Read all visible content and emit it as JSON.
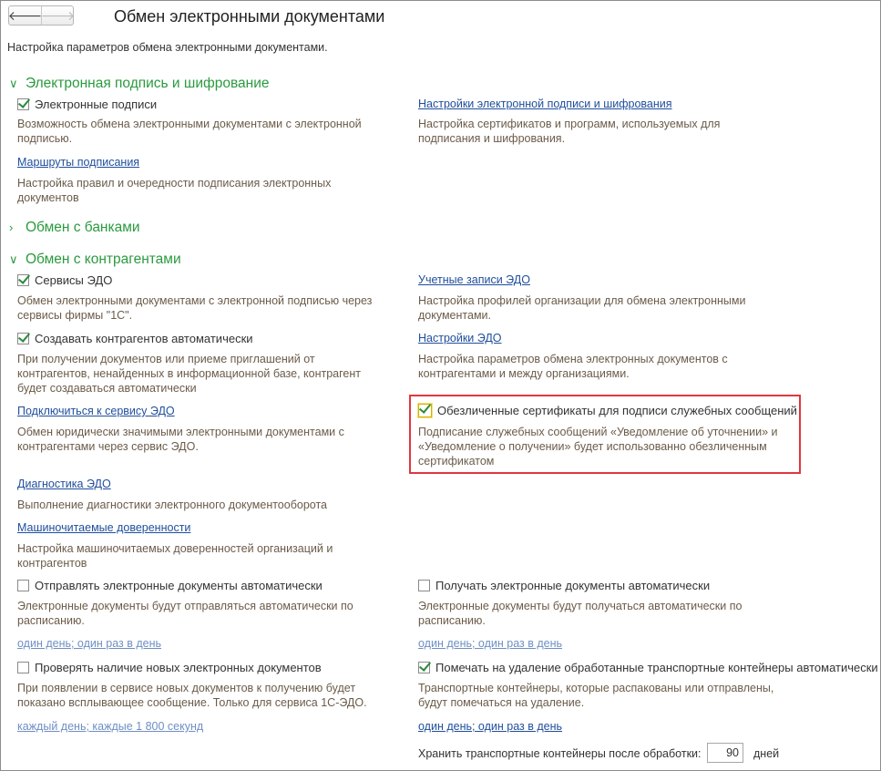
{
  "header": {
    "title": "Обмен электронными документами",
    "back": "🡐",
    "forward": "🡒"
  },
  "subtitle": "Настройка параметров обмена электронными документами.",
  "sections": {
    "signature": {
      "title": "Электронная подпись и шифрование",
      "esig_checkbox": "Электронные подписи",
      "esig_desc": "Возможность обмена электронными документами с электронной подписью.",
      "routes_link": "Маршруты подписания",
      "routes_desc": "Настройка правил и очередности подписания электронных документов",
      "settings_link": "Настройки электронной подписи и шифрования",
      "settings_desc": "Настройка сертификатов и программ, используемых для подписания и шифрования."
    },
    "banks": {
      "title": "Обмен с банками"
    },
    "counterparties": {
      "title": "Обмен с контрагентами",
      "edo_services_checkbox": "Сервисы ЭДО",
      "edo_services_desc": "Обмен электронными документами с электронной подписью через сервисы фирмы \"1С\".",
      "create_auto_checkbox": "Создавать контрагентов автоматически",
      "create_auto_desc": "При получении документов или приеме приглашений от контрагентов, ненайденных в информационной базе, контрагент будет создаваться автоматически",
      "connect_link": "Подключиться к сервису ЭДО",
      "connect_desc": "Обмен юридически значимыми электронными документами с контрагентами через сервис ЭДО.",
      "diagnostics_link": "Диагностика ЭДО",
      "diagnostics_desc": "Выполнение диагностики электронного документооборота",
      "mchd_link": "Машиночитаемые доверенности",
      "mchd_desc": "Настройка машиночитаемых доверенностей организаций и контрагентов",
      "send_auto_checkbox": "Отправлять электронные документы автоматически",
      "send_auto_desc": "Электронные документы будут отправляться автоматически по расписанию.",
      "send_schedule_link": "один день; один раз в день",
      "check_new_checkbox": "Проверять наличие новых электронных документов",
      "check_new_desc": "При появлении в сервисе новых документов к получению будет показано всплывающее сообщение. Только для сервиса 1С-ЭДО.",
      "check_schedule_link": "каждый день; каждые 1 800 секунд",
      "accounts_link": "Учетные записи ЭДО",
      "accounts_desc": "Настройка профилей организации для обмена электронными документами.",
      "edo_settings_link": "Настройки ЭДО",
      "edo_settings_desc": "Настройка параметров обмена электронных документов с контрагентами и между организациями.",
      "depersonalized_checkbox": "Обезличенные сертификаты для подписи служебных сообщений",
      "depersonalized_desc": "Подписание служебных сообщений «Уведомление об уточнении» и «Уведомление о получении» будет использованно обезличенным сертификатом",
      "receive_auto_checkbox": "Получать электронные документы автоматически",
      "receive_auto_desc": "Электронные документы будут получаться автоматически по расписанию.",
      "receive_schedule_link": "один день; один раз в день",
      "mark_delete_checkbox": "Помечать на удаление обработанные транспортные контейнеры автоматически",
      "mark_delete_desc": "Транспортные контейнеры, которые распакованы или отправлены, будут помечаться на удаление.",
      "mark_schedule_link": "один день; один раз в день",
      "keep_label": "Хранить транспортные контейнеры после обработки:",
      "keep_value": "90",
      "keep_unit": "дней"
    }
  },
  "chevrons": {
    "expanded": "∨",
    "collapsed": "›"
  },
  "checkbox_states": {
    "esig": true,
    "edo_services": true,
    "create_auto": true,
    "depersonalized": true,
    "send_auto": false,
    "check_new": false,
    "receive_auto": false,
    "mark_delete": true
  },
  "colors": {
    "section": "#2a9a3f",
    "link": "#1f4e9c",
    "highlight": "#e0373f"
  }
}
